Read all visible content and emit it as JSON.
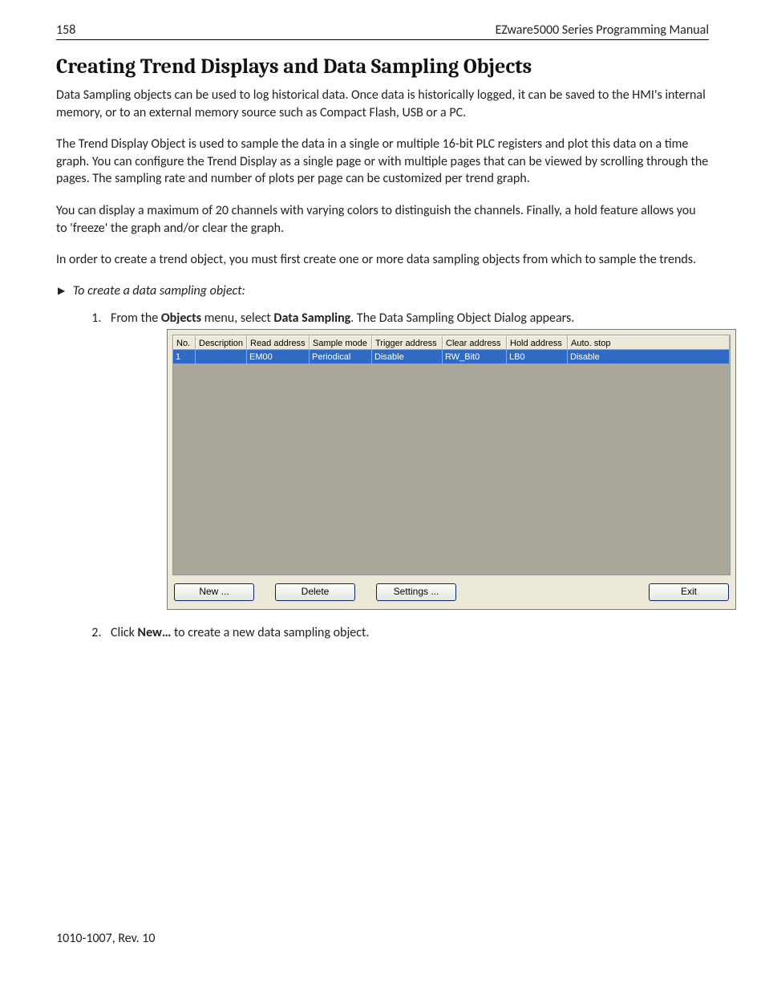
{
  "header": {
    "page_number": "158",
    "doc_title": "EZware5000 Series Programming Manual"
  },
  "section_title": "Creating Trend Displays and Data Sampling Objects",
  "paragraphs": {
    "p1": "Data Sampling objects can be used to log historical data. Once data is historically logged, it can be saved to the HMI's internal memory, or to an external memory source such as Compact Flash, USB or a PC.",
    "p2": "The Trend Display Object is used to sample the data in a single or multiple 16-bit PLC registers and plot this data on a time graph. You can configure the Trend Display as a single page or with multiple pages that can be viewed by scrolling through the pages. The sampling rate and number of plots per page can be customized per trend graph.",
    "p3": "You can display a maximum of 20 channels with varying colors to distinguish the channels. Finally, a hold feature allows you to 'freeze' the graph and/or clear the graph.",
    "p4": "In order to create a trend object, you must first create one or more data sampling objects from which to sample the trends."
  },
  "task_heading": "To create a data sampling object:",
  "steps": {
    "s1_pre": "From the ",
    "s1_bold1": "Objects",
    "s1_mid": " menu, select ",
    "s1_bold2": "Data Sampling",
    "s1_post": ". The Data Sampling Object Dialog appears.",
    "s2_pre": "Click ",
    "s2_bold": "New…",
    "s2_post": " to create a new data sampling object."
  },
  "dialog": {
    "columns": {
      "no": "No.",
      "description": "Description",
      "read_address": "Read address",
      "sample_mode": "Sample mode",
      "trigger_address": "Trigger address",
      "clear_address": "Clear address",
      "hold_address": "Hold address",
      "auto_stop": "Auto. stop"
    },
    "row": {
      "no": "1",
      "description": "",
      "read_address": "EM00",
      "sample_mode": "Periodical",
      "trigger_address": "Disable",
      "clear_address": "RW_Bit0",
      "hold_address": "LB0",
      "auto_stop": "Disable"
    },
    "buttons": {
      "new": "New ...",
      "delete": "Delete",
      "settings": "Settings ...",
      "exit": "Exit"
    }
  },
  "footer": "1010-1007, Rev. 10"
}
